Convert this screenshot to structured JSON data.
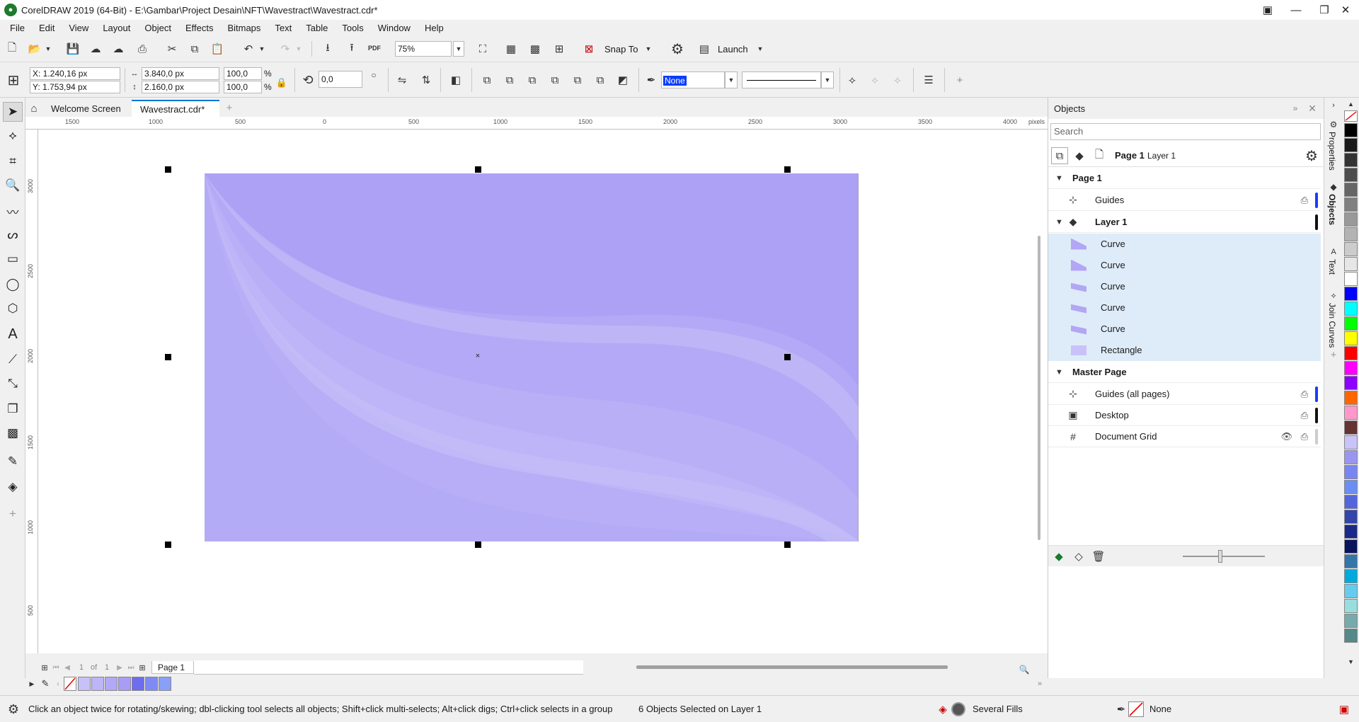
{
  "window": {
    "title": "CorelDRAW 2019 (64-Bit) - E:\\Gambar\\Project Desain\\NFT\\Wavestract\\Wavestract.cdr*"
  },
  "menu": [
    "File",
    "Edit",
    "View",
    "Layout",
    "Object",
    "Effects",
    "Bitmaps",
    "Text",
    "Table",
    "Tools",
    "Window",
    "Help"
  ],
  "standard_toolbar": {
    "zoom": "75%",
    "snap_to": "Snap To",
    "launch": "Launch",
    "pdf": "PDF"
  },
  "property_bar": {
    "x": "X: 1.240,16 px",
    "y": "Y: 1.753,94 px",
    "width": "3.840,0 px",
    "height": "2.160,0 px",
    "scale_w": "100,0",
    "scale_h": "100,0",
    "percent": "%",
    "angle": "0,0",
    "outline_width": "None"
  },
  "tabs": [
    "Welcome Screen",
    "Wavestract.cdr*"
  ],
  "ruler": {
    "h_ticks": [
      "1500",
      "1000",
      "500",
      "0",
      "500",
      "1000",
      "1500",
      "2000",
      "2500",
      "3000",
      "3500",
      "4000"
    ],
    "unit": "pixels",
    "v_ticks": [
      "3000",
      "2500",
      "2000",
      "1500",
      "1000",
      "500"
    ]
  },
  "page_nav": {
    "current": "1",
    "of": "of",
    "total": "1",
    "page_tab": "Page 1"
  },
  "document_palette": {
    "colors": [
      "#c6c2f7",
      "#bdb5f6",
      "#b2a8f5",
      "#a99cf4",
      "#6f6cf0",
      "#7f8af5",
      "#8aa0f7"
    ]
  },
  "status": {
    "hint": "Click an object twice for rotating/skewing; dbl-clicking tool selects all objects; Shift+click multi-selects; Alt+click digs; Ctrl+click selects in a group",
    "selection": "6 Objects Selected on Layer 1",
    "fill": "Several Fills",
    "outline": "None"
  },
  "objects_panel": {
    "title": "Objects",
    "search_placeholder": "Search",
    "crumb_page": "Page 1",
    "crumb_layer": "Layer 1",
    "page": "Page 1",
    "guides": "Guides",
    "layer": "Layer 1",
    "items": [
      "Curve",
      "Curve",
      "Curve",
      "Curve",
      "Curve",
      "Rectangle"
    ],
    "master_page": "Master Page",
    "master_items": [
      "Guides (all pages)",
      "Desktop",
      "Document Grid"
    ]
  },
  "dockers": [
    "Properties",
    "Objects",
    "Text",
    "Join Curves"
  ],
  "colors": {
    "wave_base": "#aca1f5",
    "wave_mid": "#b5abf6",
    "wave_light": "#c2baf8",
    "accent_blue": "#0a3cff"
  },
  "color_palette": [
    "#000000",
    "#1a1a1a",
    "#333333",
    "#4d4d4d",
    "#666666",
    "#808080",
    "#999999",
    "#b3b3b3",
    "#cccccc",
    "#e6e6e6",
    "#ffffff",
    "#0000ff",
    "#00ffff",
    "#00ff00",
    "#ffff00",
    "#ff0000",
    "#ff00ff",
    "#8b00ff",
    "#ff6600",
    "#ff99cc",
    "#663333",
    "#c8c4f8",
    "#9a96f0",
    "#7a86f0",
    "#6b8ef5",
    "#5566dd",
    "#3344aa",
    "#1b2a88",
    "#0a1560",
    "#3377aa",
    "#00aadd",
    "#66ccee",
    "#99dddd",
    "#77aaaa",
    "#558888"
  ]
}
